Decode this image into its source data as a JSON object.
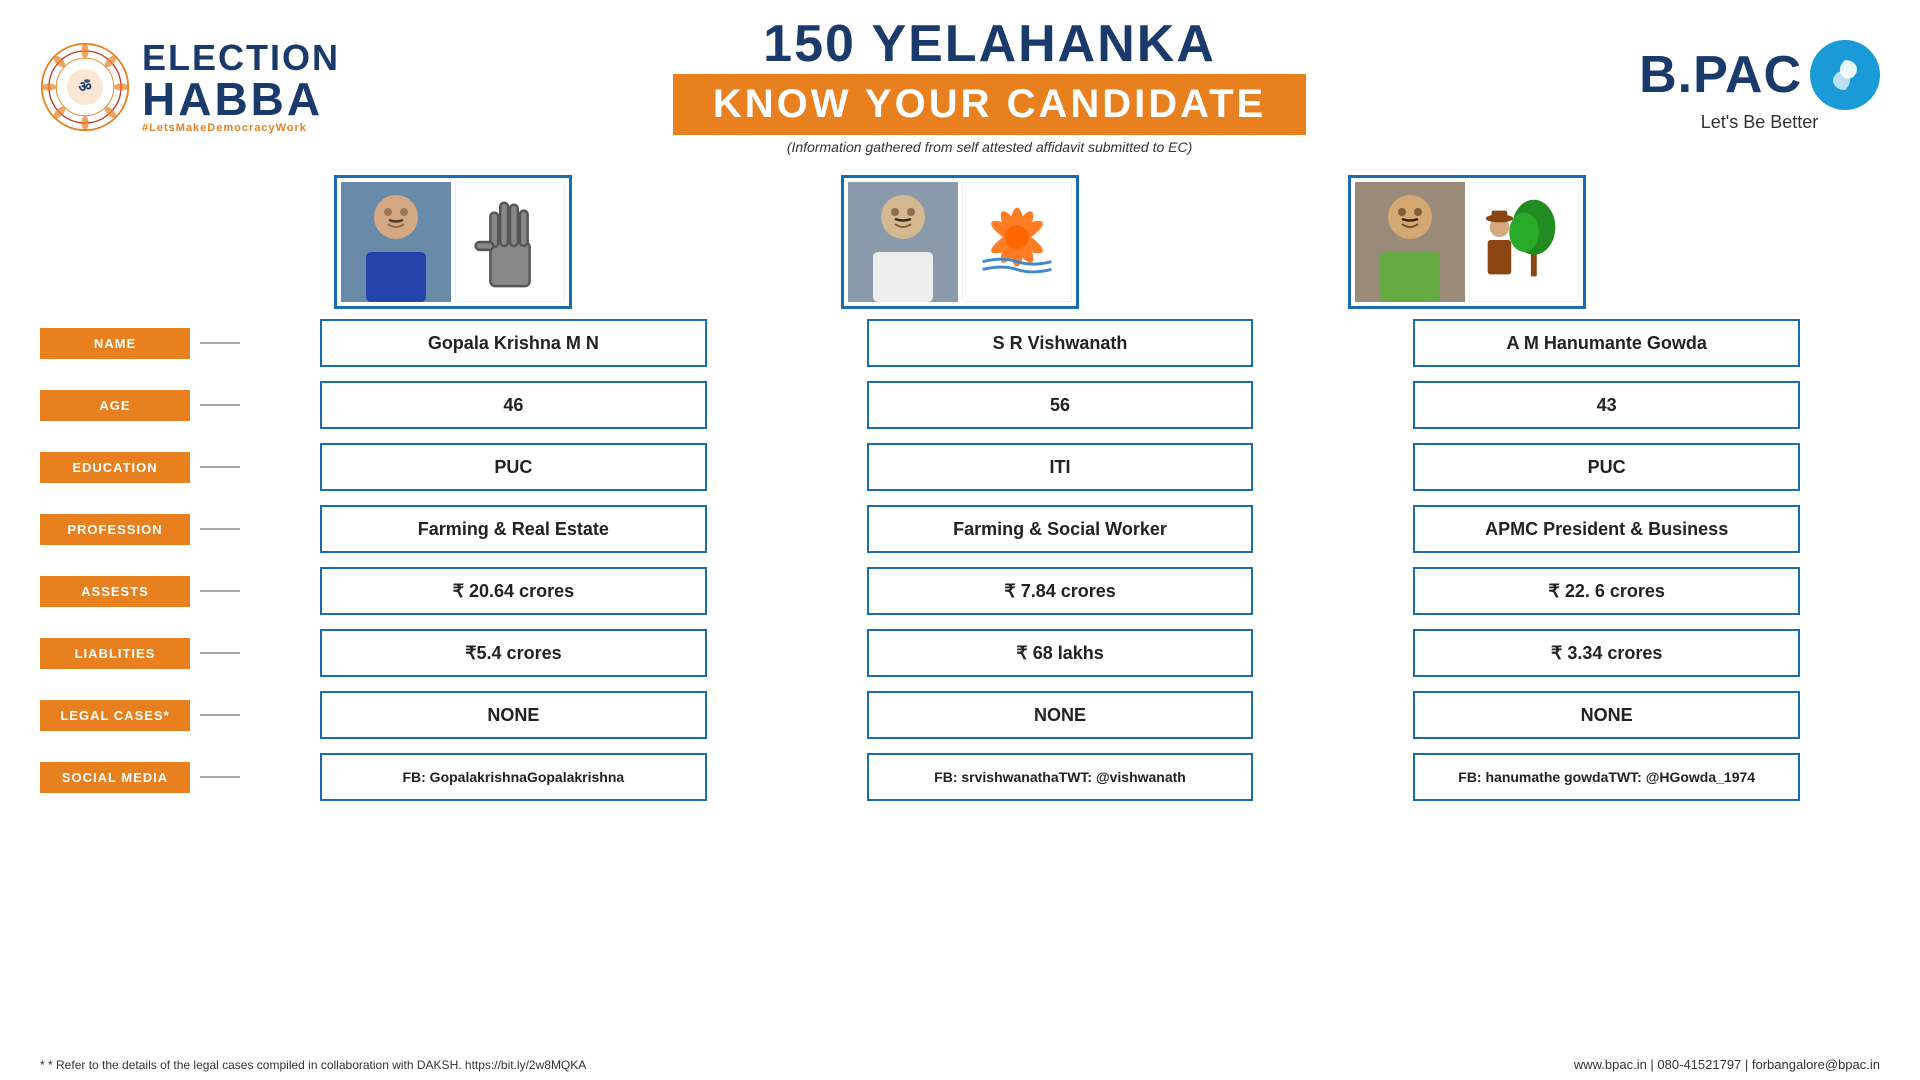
{
  "header": {
    "election_habba_line1": "ELECTION",
    "election_habba_line2": "HABBA",
    "tagline": "#LetsMakeDemocracyWork",
    "title_number": "150 YELAHANKA",
    "know_your_candidate": "KNOW YOUR CANDIDATE",
    "subtitle": "(Information gathered from self attested affidavit submitted to EC)",
    "bpac_name": "B.PAC",
    "lets_be_better": "Let's Be Better"
  },
  "labels": {
    "name": "NAME",
    "age": "AGE",
    "education": "EDUCATION",
    "profession": "PROFESSION",
    "assets": "ASSESTS",
    "liabilities": "LIABLITIES",
    "legal_cases": "LEGAL CASES*",
    "social_media": "SOCIAL MEDIA"
  },
  "candidates": [
    {
      "id": "candidate-1",
      "name": "Gopala Krishna M N",
      "age": "46",
      "education": "PUC",
      "profession": "Farming & Real Estate",
      "assets": "₹ 20.64 crores",
      "liabilities": "₹5.4 crores",
      "legal_cases": "NONE",
      "social_media": "FB: GopalakrishnaGopalakrishna",
      "party_symbol": "hand"
    },
    {
      "id": "candidate-2",
      "name": "S R Vishwanath",
      "age": "56",
      "education": "ITI",
      "profession": "Farming & Social Worker",
      "assets": "₹ 7.84 crores",
      "liabilities": "₹ 68 lakhs",
      "legal_cases": "NONE",
      "social_media_line1": "FB: srvishwanatha",
      "social_media_line2": "TWT: @vishwanath",
      "party_symbol": "lotus"
    },
    {
      "id": "candidate-3",
      "name": "A M Hanumante Gowda",
      "age": "43",
      "education": "PUC",
      "profession": "APMC President & Business",
      "assets": "₹ 22. 6 crores",
      "liabilities": "₹  3.34 crores",
      "legal_cases": "NONE",
      "social_media_line1": "FB: hanumathe gowda",
      "social_media_line2": "TWT: @HGowda_1974",
      "party_symbol": "farmer"
    }
  ],
  "footer": {
    "asterisk_note": "* Refer to the details of the legal cases compiled in collaboration with DAKSH.  https://bit.ly/2w8MQKA",
    "contact": "www.bpac.in | 080-41521797 | forbangalore@bpac.in"
  }
}
